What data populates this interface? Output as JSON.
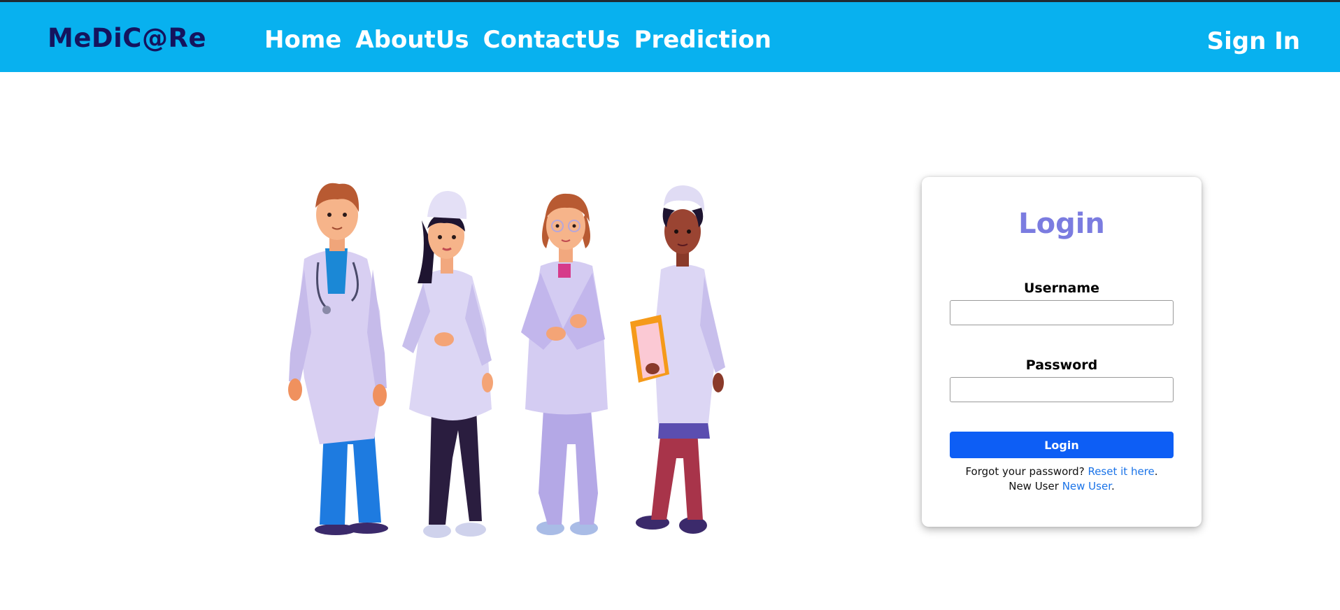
{
  "brand": "MeDiC@Re",
  "nav": {
    "links": [
      "Home",
      "AboutUs",
      "ContactUs",
      "Prediction"
    ],
    "sign_in": "Sign In"
  },
  "colors": {
    "navbar": "#08b1ef",
    "brand_text": "#14145e",
    "login_title": "#7b7ce0",
    "login_button": "#0d5ef5",
    "link": "#1a73e8"
  },
  "hero": {
    "image": "four-doctors-illustration"
  },
  "login": {
    "title": "Login",
    "username_label": "Username",
    "username_value": "",
    "password_label": "Password",
    "password_value": "",
    "button_label": "Login",
    "forgot_text": "Forgot your password?",
    "forgot_link": "Reset it here",
    "forgot_suffix": ".",
    "new_user_text": "New User",
    "new_user_link": "New User",
    "new_user_suffix": "."
  }
}
